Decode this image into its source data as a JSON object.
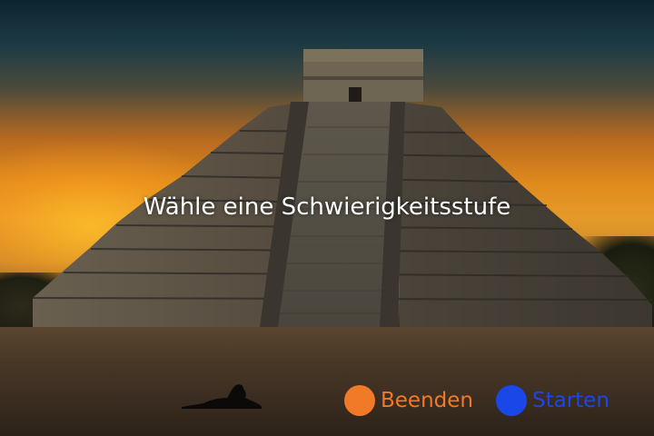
{
  "screen": {
    "title": "Wähle eine Schwierigkeitsstufe"
  },
  "buttons": {
    "quit": {
      "label": "Beenden",
      "color": "#f07a28"
    },
    "start": {
      "label": "Starten",
      "color": "#1a47e8"
    }
  },
  "background": {
    "scene": "pyramid-at-sunset",
    "sky_color": "#e08a1c",
    "stone_color": "#5b5348"
  }
}
